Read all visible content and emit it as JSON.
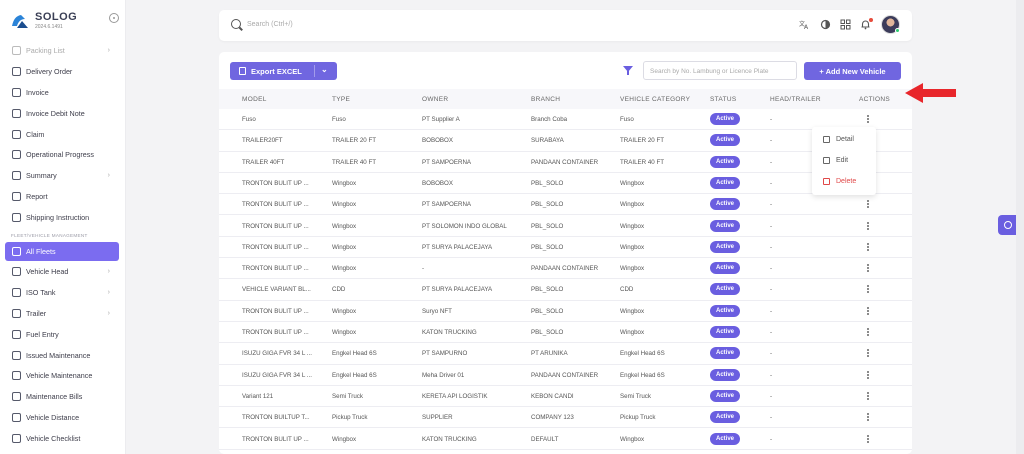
{
  "app": {
    "name": "SOLOG",
    "version": "2024.6.1491"
  },
  "colors": {
    "accent": "#7066e0",
    "active_nav": "#7b6cf0",
    "danger": "#e04848",
    "annotation_arrow": "#e8262b"
  },
  "sidebar": {
    "items": [
      {
        "label": "Packing List",
        "icon": "packing-list-icon",
        "chevron": true,
        "faded": true
      },
      {
        "label": "Delivery Order",
        "icon": "truck-icon",
        "chevron": false
      },
      {
        "label": "Invoice",
        "icon": "document-icon",
        "chevron": false
      },
      {
        "label": "Invoice Debit Note",
        "icon": "document-icon",
        "chevron": false
      },
      {
        "label": "Claim",
        "icon": "claim-icon",
        "chevron": false
      },
      {
        "label": "Operational Progress",
        "icon": "progress-icon",
        "chevron": false
      },
      {
        "label": "Summary",
        "icon": "summary-icon",
        "chevron": true
      },
      {
        "label": "Report",
        "icon": "report-icon",
        "chevron": false
      },
      {
        "label": "Shipping Instruction",
        "icon": "shipping-icon",
        "chevron": false
      }
    ],
    "section_label": "FLEET/VEHICLE MANAGEMENT",
    "fleet_items": [
      {
        "label": "All Fleets",
        "icon": "fleet-icon",
        "chevron": false,
        "active": true
      },
      {
        "label": "Vehicle Head",
        "icon": "vehicle-head-icon",
        "chevron": true
      },
      {
        "label": "ISO Tank",
        "icon": "iso-tank-icon",
        "chevron": true
      },
      {
        "label": "Trailer",
        "icon": "trailer-icon",
        "chevron": true
      },
      {
        "label": "Fuel Entry",
        "icon": "fuel-icon",
        "chevron": false
      },
      {
        "label": "Issued Maintenance",
        "icon": "maintenance-icon",
        "chevron": false
      },
      {
        "label": "Vehicle Maintenance",
        "icon": "wrench-icon",
        "chevron": false
      },
      {
        "label": "Maintenance Bills",
        "icon": "bill-icon",
        "chevron": false
      },
      {
        "label": "Vehicle Distance",
        "icon": "distance-icon",
        "chevron": false
      },
      {
        "label": "Vehicle Checklist",
        "icon": "checklist-icon",
        "chevron": false
      }
    ]
  },
  "topbar": {
    "search_placeholder": "Search (Ctrl+/)",
    "icons": [
      "translate-icon",
      "theme-icon",
      "apps-icon",
      "bell-icon"
    ]
  },
  "toolbar": {
    "export_label": "Export EXCEL",
    "search_placeholder": "Search by No. Lambung or Licence Plate",
    "add_label": "+ Add New Vehicle"
  },
  "table": {
    "headers": [
      "MODEL",
      "TYPE",
      "OWNER",
      "BRANCH",
      "VEHICLE CATEGORY",
      "STATUS",
      "HEAD/TRAILER",
      "ACTIONS"
    ],
    "rows": [
      [
        "Fuso",
        "Fuso",
        "PT Supplier A",
        "Branch Coba",
        "Fuso",
        "Active",
        "-"
      ],
      [
        "TRAILER20FT",
        "TRAILER 20 FT",
        "BOBOBOX",
        "SURABAYA",
        "TRAILER 20 FT",
        "Active",
        "-"
      ],
      [
        "TRAILER 40FT",
        "TRAILER 40 FT",
        "PT SAMPOERNA",
        "PANDAAN CONTAINER",
        "TRAILER 40 FT",
        "Active",
        "-"
      ],
      [
        "TRONTON BULIT UP ...",
        "Wingbox",
        "BOBOBOX",
        "PBL_SOLO",
        "Wingbox",
        "Active",
        "-"
      ],
      [
        "TRONTON BULIT UP ...",
        "Wingbox",
        "PT SAMPOERNA",
        "PBL_SOLO",
        "Wingbox",
        "Active",
        "-"
      ],
      [
        "TRONTON BULIT UP ...",
        "Wingbox",
        "PT SOLOMON INDO GLOBAL",
        "PBL_SOLO",
        "Wingbox",
        "Active",
        "-"
      ],
      [
        "TRONTON BULIT UP ...",
        "Wingbox",
        "PT SURYA PALACEJAYA",
        "PBL_SOLO",
        "Wingbox",
        "Active",
        "-"
      ],
      [
        "TRONTON BULIT UP ...",
        "Wingbox",
        "-",
        "PANDAAN CONTAINER",
        "Wingbox",
        "Active",
        "-"
      ],
      [
        "VEHICLE VARIANT BL...",
        "CDD",
        "PT SURYA PALACEJAYA",
        "PBL_SOLO",
        "CDD",
        "Active",
        "-"
      ],
      [
        "TRONTON BULIT UP ...",
        "Wingbox",
        "Suryo NFT",
        "PBL_SOLO",
        "Wingbox",
        "Active",
        "-"
      ],
      [
        "TRONTON BULIT UP ...",
        "Wingbox",
        "KATON TRUCKING",
        "PBL_SOLO",
        "Wingbox",
        "Active",
        "-"
      ],
      [
        "ISUZU GIGA FVR 34 L ...",
        "Engkel Head 6S",
        "PT SAMPURNO",
        "PT ARUNIKA",
        "Engkel Head 6S",
        "Active",
        "-"
      ],
      [
        "ISUZU GIGA FVR 34 L ...",
        "Engkel Head 6S",
        "Meha Driver 01",
        "PANDAAN CONTAINER",
        "Engkel Head 6S",
        "Active",
        "-"
      ],
      [
        "Variant 121",
        "Semi Truck",
        "KERETA API LOGISTIK",
        "KEBON CANDI",
        "Semi Truck",
        "Active",
        "-"
      ],
      [
        "TRONTON BUILTUP T...",
        "Pickup Truck",
        "SUPPLIER",
        "COMPANY 123",
        "Pickup Truck",
        "Active",
        "-"
      ],
      [
        "TRONTON BULIT UP ...",
        "Wingbox",
        "KATON TRUCKING",
        "DEFAULT",
        "Wingbox",
        "Active",
        "-"
      ]
    ]
  },
  "action_menu": {
    "items": [
      {
        "label": "Detail",
        "icon": "folder-icon"
      },
      {
        "label": "Edit",
        "icon": "edit-icon"
      },
      {
        "label": "Delete",
        "icon": "trash-icon"
      }
    ]
  }
}
